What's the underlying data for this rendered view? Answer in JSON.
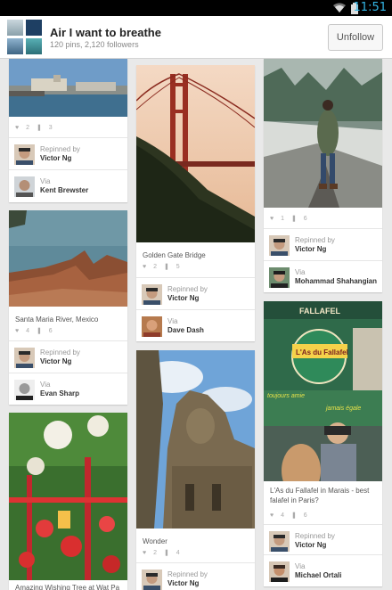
{
  "statusbar": {
    "time": "11:51"
  },
  "header": {
    "board_title": "Air I want to breathe",
    "board_meta": "120 pins, 2,120 followers",
    "unfollow_label": "Unfollow"
  },
  "pins": [
    {
      "desc": "",
      "likes": "2",
      "repins": "3",
      "repinned_by_label": "Repinned by",
      "repinned_by": "Victor Ng",
      "via_label": "Via",
      "via": "Kent Brewster"
    },
    {
      "desc": "Santa Maria River, Mexico",
      "likes": "4",
      "repins": "6",
      "repinned_by_label": "Repinned by",
      "repinned_by": "Victor Ng",
      "via_label": "Via",
      "via": "Evan Sharp"
    },
    {
      "desc": "Amazing Wishing Tree at Wat Pa",
      "likes": "",
      "repins": ""
    },
    {
      "desc": "Golden Gate Bridge",
      "likes": "2",
      "repins": "5",
      "repinned_by_label": "Repinned by",
      "repinned_by": "Victor Ng",
      "via_label": "Via",
      "via": "Dave Dash"
    },
    {
      "desc": "Wonder",
      "likes": "2",
      "repins": "4",
      "repinned_by_label": "Repinned by",
      "repinned_by": "Victor Ng"
    },
    {
      "desc": "",
      "likes": "1",
      "repins": "6",
      "repinned_by_label": "Repinned by",
      "repinned_by": "Victor Ng",
      "via_label": "Via",
      "via": "Mohammad Shahangian"
    },
    {
      "desc": "L'As du Fallafel in Marais - best falafel in Paris?",
      "likes": "4",
      "repins": "6",
      "repinned_by_label": "Repinned by",
      "repinned_by": "Victor Ng",
      "via_label": "Via",
      "via": "Michael Ortali",
      "img_text": "L'As du Fallafel",
      "img_text2": "FALLAFEL",
      "img_text3": "toujours amie",
      "img_text4": "jamais égale"
    }
  ],
  "icons": {
    "wifi": "wifi-icon",
    "battery": "battery-icon",
    "like": "heart-icon",
    "repin": "pin-icon"
  }
}
